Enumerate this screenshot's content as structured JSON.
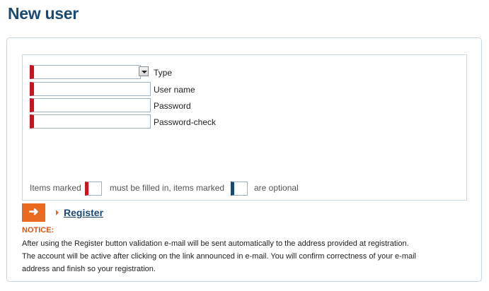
{
  "page": {
    "title": "New user"
  },
  "form": {
    "fields": [
      {
        "label": "Type",
        "kind": "select",
        "value": "",
        "required": true
      },
      {
        "label": "User name",
        "kind": "text",
        "value": "",
        "required": true
      },
      {
        "label": "Password",
        "kind": "text",
        "value": "",
        "required": true
      },
      {
        "label": "Password-check",
        "kind": "text",
        "value": "",
        "required": true
      }
    ],
    "legend": {
      "prefix": "Items marked",
      "middle": "must be filled in, items marked",
      "suffix": "are optional"
    }
  },
  "actions": {
    "register_label": "Register",
    "arrow_icon": "arrow-right-icon",
    "arrow_glyph": "➜"
  },
  "notice": {
    "title": "NOTICE:",
    "lines": [
      "After using the Register button validation e-mail will be sent automatically to the address provided at registration.",
      "The account will be active after clicking on the link announced in e-mail. You will confirm correctness of your e-mail",
      "address and finish so your registration."
    ]
  },
  "colors": {
    "title": "#1a4a72",
    "required_marker": "#c8141e",
    "optional_marker": "#1a4a72",
    "accent": "#ea6a22",
    "notice_title": "#d2571a"
  }
}
